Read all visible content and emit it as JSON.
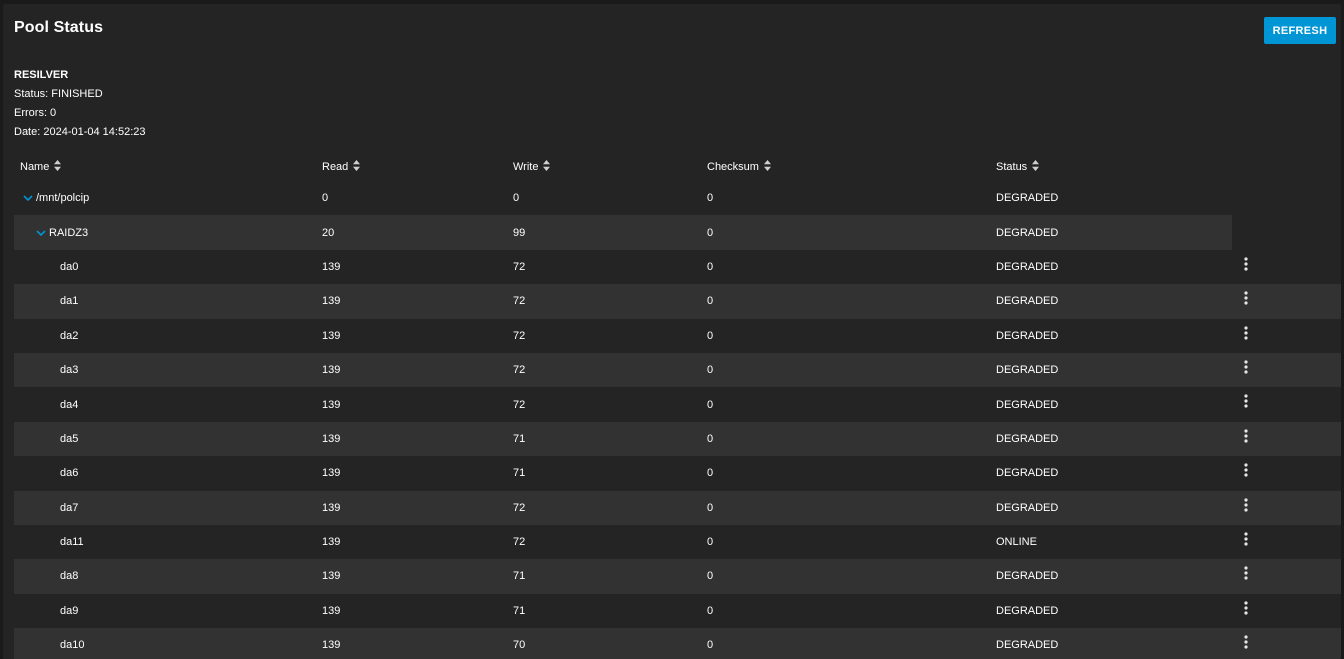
{
  "header": {
    "title": "Pool Status",
    "refresh_label": "REFRESH"
  },
  "scan": {
    "type": "RESILVER",
    "status": "Status: FINISHED",
    "errors": "Errors: 0",
    "date": "Date: 2024-01-04 14:52:23"
  },
  "table": {
    "columns": [
      "Name",
      "Read",
      "Write",
      "Checksum",
      "Status"
    ],
    "icons": {
      "sort": "sort-icon",
      "expand": "chevron-down-icon",
      "actions": "more-vert-icon"
    },
    "colors": {
      "accent": "#0095d5",
      "card": "#242424",
      "stripe": "#323232"
    },
    "rows": [
      {
        "name": "/mnt/polcip",
        "read": "0",
        "write": "0",
        "checksum": "0",
        "status": "DEGRADED"
      },
      {
        "name": "RAIDZ3",
        "read": "20",
        "write": "99",
        "checksum": "0",
        "status": "DEGRADED"
      },
      {
        "name": "da0",
        "read": "139",
        "write": "72",
        "checksum": "0",
        "status": "DEGRADED"
      },
      {
        "name": "da1",
        "read": "139",
        "write": "72",
        "checksum": "0",
        "status": "DEGRADED"
      },
      {
        "name": "da2",
        "read": "139",
        "write": "72",
        "checksum": "0",
        "status": "DEGRADED"
      },
      {
        "name": "da3",
        "read": "139",
        "write": "72",
        "checksum": "0",
        "status": "DEGRADED"
      },
      {
        "name": "da4",
        "read": "139",
        "write": "72",
        "checksum": "0",
        "status": "DEGRADED"
      },
      {
        "name": "da5",
        "read": "139",
        "write": "71",
        "checksum": "0",
        "status": "DEGRADED"
      },
      {
        "name": "da6",
        "read": "139",
        "write": "71",
        "checksum": "0",
        "status": "DEGRADED"
      },
      {
        "name": "da7",
        "read": "139",
        "write": "72",
        "checksum": "0",
        "status": "DEGRADED"
      },
      {
        "name": "da11",
        "read": "139",
        "write": "72",
        "checksum": "0",
        "status": "ONLINE"
      },
      {
        "name": "da8",
        "read": "139",
        "write": "71",
        "checksum": "0",
        "status": "DEGRADED"
      },
      {
        "name": "da9",
        "read": "139",
        "write": "71",
        "checksum": "0",
        "status": "DEGRADED"
      },
      {
        "name": "da10",
        "read": "139",
        "write": "70",
        "checksum": "0",
        "status": "DEGRADED"
      }
    ]
  }
}
